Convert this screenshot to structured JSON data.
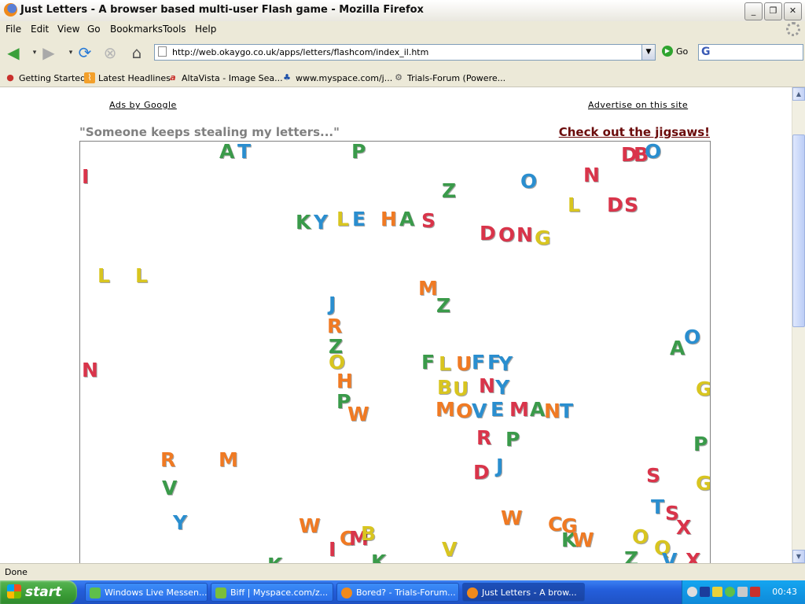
{
  "window": {
    "title": "Just Letters - A browser based multi-user Flash game - Mozilla Firefox",
    "minimize": "_",
    "restore": "❐",
    "close": "✕"
  },
  "menu": [
    "File",
    "Edit",
    "View",
    "Go",
    "Bookmarks",
    "Tools",
    "Help"
  ],
  "nav": {
    "url": "http://web.okaygo.co.uk/apps/letters/flashcom/index_il.htm",
    "go_label": "Go"
  },
  "bookmarks": [
    {
      "label": "Getting Started",
      "icon": "firefox-icon"
    },
    {
      "label": "Latest Headlines",
      "icon": "rss-icon"
    },
    {
      "label": "AltaVista - Image Sea...",
      "icon": "altavista-icon"
    },
    {
      "label": "www.myspace.com/j...",
      "icon": "myspace-icon"
    },
    {
      "label": "Trials-Forum (Powere...",
      "icon": "gear-icon"
    }
  ],
  "page": {
    "ads_by_google": "Ads by Google",
    "advertise": "Advertise on this site",
    "tagline": "\"Someone keeps stealing my letters...\"",
    "jigsaw_link": "Check out the jigsaws!"
  },
  "colors": {
    "red": "#d9344a",
    "orange": "#f07a23",
    "yellow": "#d8c520",
    "green": "#3a9a4a",
    "blue": "#2a8ecf"
  },
  "letters": [
    {
      "ch": "A",
      "c": "green"
    },
    {
      "ch": "T",
      "c": "blue"
    },
    {
      "ch": "P",
      "c": "green"
    },
    {
      "ch": "D",
      "c": "red"
    },
    {
      "ch": "B",
      "c": "red"
    },
    {
      "ch": "O",
      "c": "blue"
    },
    {
      "ch": "I",
      "c": "red"
    },
    {
      "ch": "N",
      "c": "red"
    },
    {
      "ch": "O",
      "c": "blue"
    },
    {
      "ch": "Z",
      "c": "green"
    },
    {
      "ch": "L",
      "c": "yellow"
    },
    {
      "ch": "D",
      "c": "red"
    },
    {
      "ch": "S",
      "c": "red"
    },
    {
      "ch": "K",
      "c": "green"
    },
    {
      "ch": "Y",
      "c": "blue"
    },
    {
      "ch": "L",
      "c": "yellow"
    },
    {
      "ch": "E",
      "c": "blue"
    },
    {
      "ch": "H",
      "c": "orange"
    },
    {
      "ch": "A",
      "c": "green"
    },
    {
      "ch": "S",
      "c": "red"
    },
    {
      "ch": "D",
      "c": "red"
    },
    {
      "ch": "O",
      "c": "red"
    },
    {
      "ch": "N",
      "c": "red"
    },
    {
      "ch": "G",
      "c": "yellow"
    },
    {
      "ch": "L",
      "c": "yellow"
    },
    {
      "ch": "L",
      "c": "yellow"
    },
    {
      "ch": "M",
      "c": "orange"
    },
    {
      "ch": "Z",
      "c": "green"
    },
    {
      "ch": "J",
      "c": "blue"
    },
    {
      "ch": "R",
      "c": "orange"
    },
    {
      "ch": "Z",
      "c": "green"
    },
    {
      "ch": "O",
      "c": "yellow"
    },
    {
      "ch": "A",
      "c": "green"
    },
    {
      "ch": "O",
      "c": "blue"
    },
    {
      "ch": "N",
      "c": "red"
    },
    {
      "ch": "H",
      "c": "orange"
    },
    {
      "ch": "P",
      "c": "green"
    },
    {
      "ch": "W",
      "c": "orange"
    },
    {
      "ch": "F",
      "c": "green"
    },
    {
      "ch": "L",
      "c": "yellow"
    },
    {
      "ch": "U",
      "c": "orange"
    },
    {
      "ch": "F",
      "c": "blue"
    },
    {
      "ch": "F",
      "c": "blue"
    },
    {
      "ch": "Y",
      "c": "blue"
    },
    {
      "ch": "B",
      "c": "yellow"
    },
    {
      "ch": "U",
      "c": "yellow"
    },
    {
      "ch": "N",
      "c": "red"
    },
    {
      "ch": "Y",
      "c": "blue"
    },
    {
      "ch": "G",
      "c": "yellow"
    },
    {
      "ch": "M",
      "c": "orange"
    },
    {
      "ch": "O",
      "c": "orange"
    },
    {
      "ch": "V",
      "c": "blue"
    },
    {
      "ch": "E",
      "c": "blue"
    },
    {
      "ch": "M",
      "c": "red"
    },
    {
      "ch": "A",
      "c": "green"
    },
    {
      "ch": "N",
      "c": "orange"
    },
    {
      "ch": "T",
      "c": "blue"
    },
    {
      "ch": "R",
      "c": "red"
    },
    {
      "ch": "P",
      "c": "green"
    },
    {
      "ch": "P",
      "c": "green"
    },
    {
      "ch": "D",
      "c": "red"
    },
    {
      "ch": "J",
      "c": "blue"
    },
    {
      "ch": "S",
      "c": "red"
    },
    {
      "ch": "G",
      "c": "yellow"
    },
    {
      "ch": "R",
      "c": "orange"
    },
    {
      "ch": "M",
      "c": "orange"
    },
    {
      "ch": "V",
      "c": "green"
    },
    {
      "ch": "T",
      "c": "blue"
    },
    {
      "ch": "S",
      "c": "red"
    },
    {
      "ch": "X",
      "c": "red"
    },
    {
      "ch": "Y",
      "c": "blue"
    },
    {
      "ch": "W",
      "c": "orange"
    },
    {
      "ch": "W",
      "c": "orange"
    },
    {
      "ch": "C",
      "c": "orange"
    },
    {
      "ch": "G",
      "c": "orange"
    },
    {
      "ch": "K",
      "c": "green"
    },
    {
      "ch": "W",
      "c": "orange"
    },
    {
      "ch": "I",
      "c": "red"
    },
    {
      "ch": "C",
      "c": "orange"
    },
    {
      "ch": "M",
      "c": "red"
    },
    {
      "ch": "B",
      "c": "yellow"
    },
    {
      "ch": "V",
      "c": "yellow"
    },
    {
      "ch": "O",
      "c": "yellow"
    },
    {
      "ch": "Q",
      "c": "yellow"
    },
    {
      "ch": "V",
      "c": "blue"
    },
    {
      "ch": "Z",
      "c": "green"
    },
    {
      "ch": "X",
      "c": "red"
    },
    {
      "ch": "K",
      "c": "green"
    },
    {
      "ch": "K",
      "c": "green"
    }
  ],
  "status": "Done",
  "taskbar": {
    "start": "start",
    "tasks": [
      {
        "label": "Windows Live Messen...",
        "icon_color": "#5fbf4a"
      },
      {
        "label": "Biff | Myspace.com/z...",
        "icon_color": "#7bbf3a"
      },
      {
        "label": "Bored? - Trials-Forum...",
        "icon_color": "#f08a1c"
      },
      {
        "label": "Just Letters - A brow...",
        "icon_color": "#f08a1c"
      }
    ],
    "clock": "00:43"
  }
}
